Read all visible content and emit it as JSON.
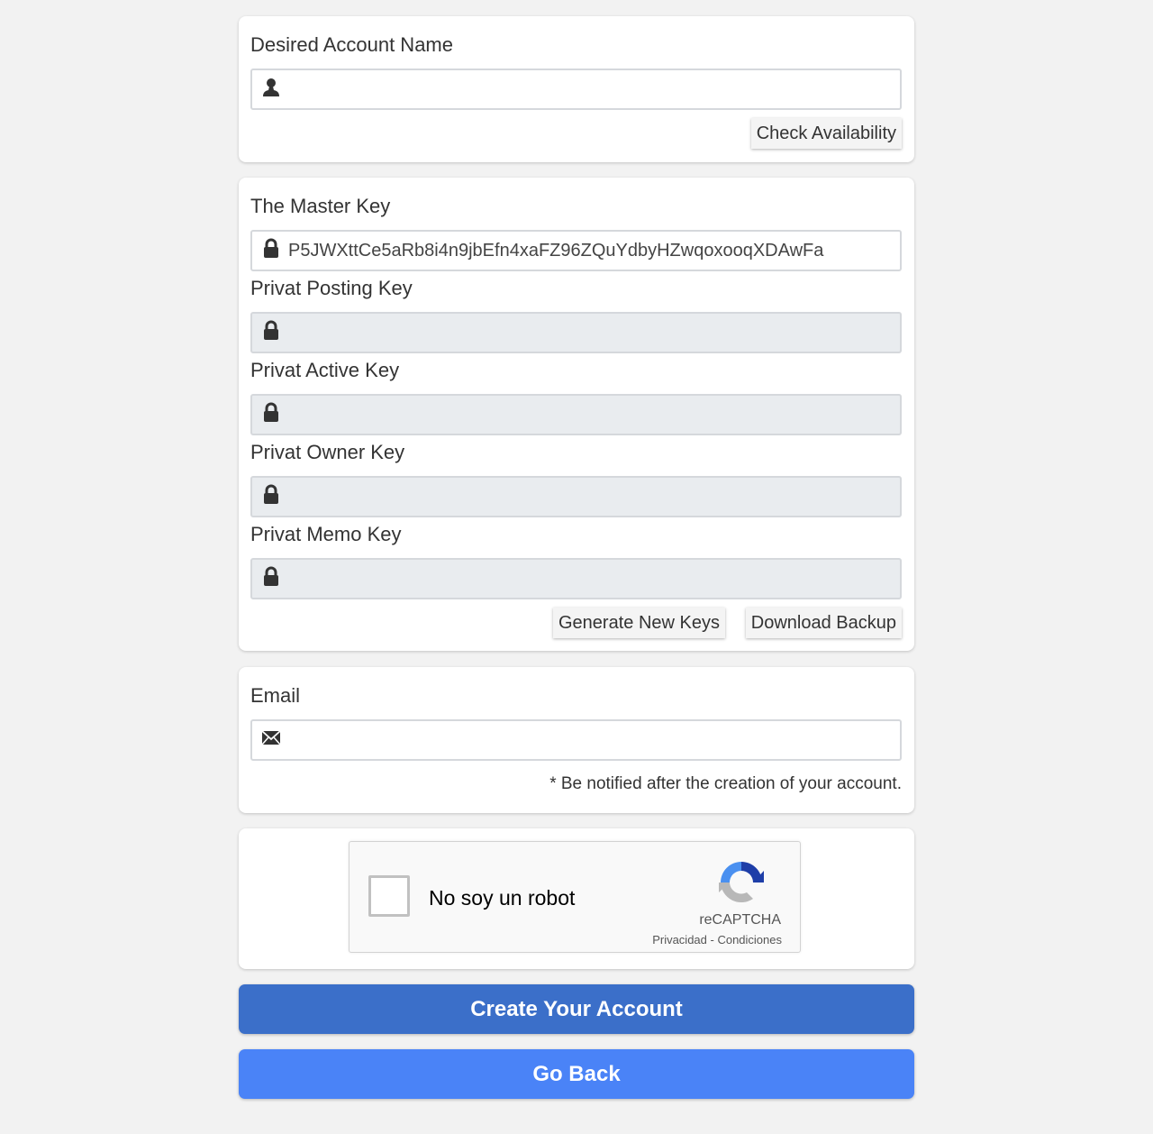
{
  "account_section": {
    "label": "Desired Account Name",
    "input_value": "",
    "input_placeholder": "",
    "icon": "user-icon",
    "check_button": "Check Availability"
  },
  "keys_section": {
    "master": {
      "label": "The Master Key",
      "value": "P5JWXttCe5aRb8i4n9jbEfn4xaFZ96ZQuYdbyHZwqoxooqXDAwFa",
      "icon": "lock-icon"
    },
    "posting": {
      "label": "Privat Posting Key",
      "value": "",
      "icon": "lock-icon"
    },
    "active": {
      "label": "Privat Active Key",
      "value": "",
      "icon": "lock-icon"
    },
    "owner": {
      "label": "Privat Owner Key",
      "value": "",
      "icon": "lock-icon"
    },
    "memo": {
      "label": "Privat Memo Key",
      "value": "",
      "icon": "lock-icon"
    },
    "generate_button": "Generate New Keys",
    "download_button": "Download Backup"
  },
  "email_section": {
    "label": "Email",
    "input_value": "",
    "icon": "envelope-icon",
    "note": "* Be notified after the creation of your account."
  },
  "captcha": {
    "label": "No soy un robot",
    "brand": "reCAPTCHA",
    "privacy": "Privacidad",
    "separator": " - ",
    "terms": "Condiciones",
    "checked": false
  },
  "actions": {
    "create_button": "Create Your Account",
    "back_button": "Go Back",
    "create_color": "#3b6fc9",
    "back_color": "#4a83f7"
  }
}
